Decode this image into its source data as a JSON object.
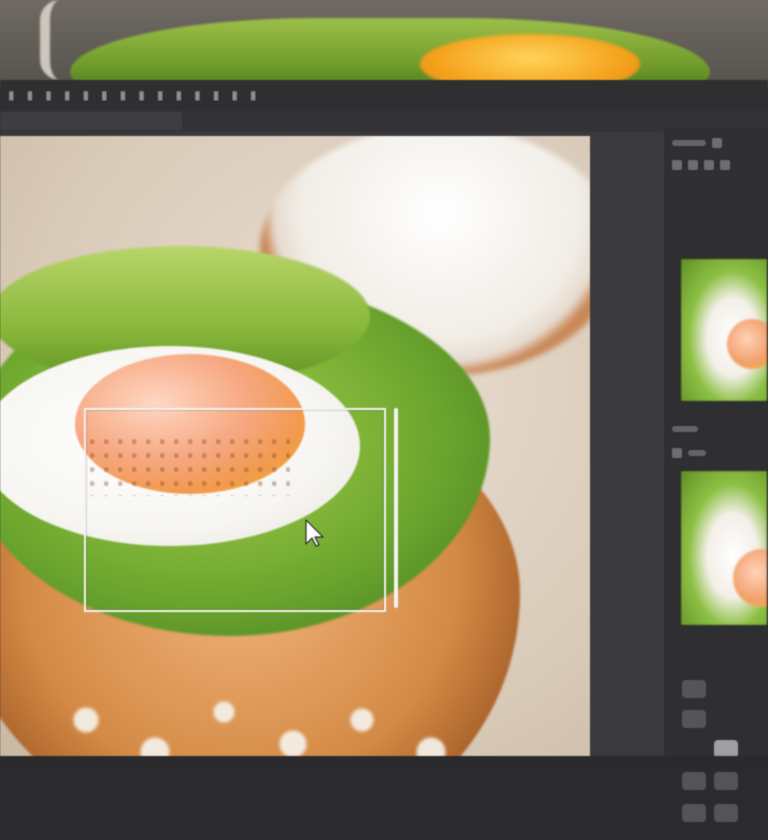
{
  "app": {
    "menubar": {
      "items": [
        "▮",
        "▮",
        "▮",
        "▮",
        "▮",
        "▮",
        "▮",
        "▮",
        "▮",
        "▮",
        "▮",
        "▮",
        "▮",
        "▮"
      ]
    },
    "colors": {
      "chrome_dark": "#2f2f31",
      "chrome_mid": "#3a3a3d",
      "selection": "#f3f3f3",
      "avocado_green": "#88b73a",
      "yolk_orange": "#f29a4e",
      "toast_brown": "#d48a45"
    },
    "icons": {
      "cursor": "arrow-cursor-icon"
    }
  }
}
